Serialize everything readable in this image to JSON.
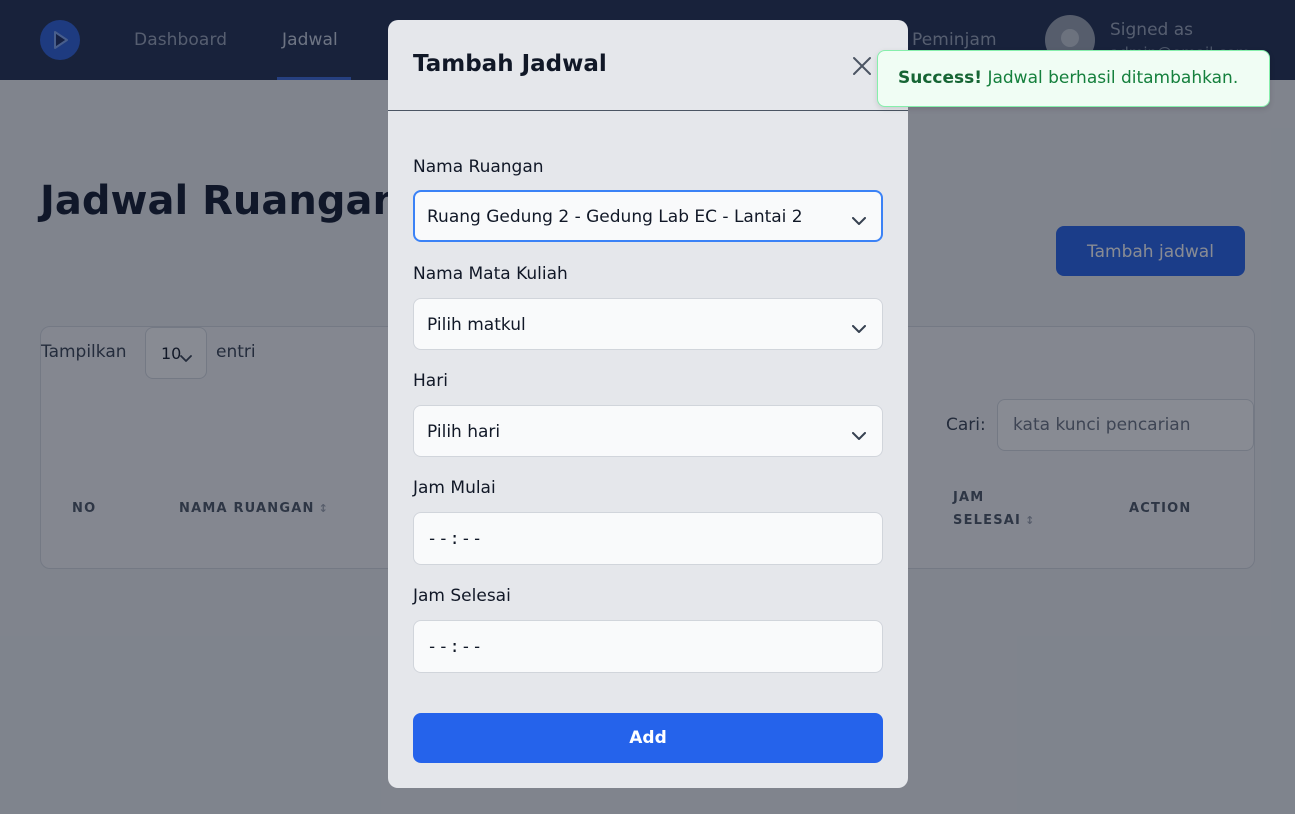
{
  "navbar": {
    "items": [
      {
        "label": "Dashboard"
      },
      {
        "label": "Jadwal"
      },
      {
        "label": "Peminjam"
      }
    ],
    "user": {
      "signed_label": "Signed as",
      "account": "admin@email.com"
    }
  },
  "page": {
    "title": "Jadwal Ruangan Kuliah",
    "add_button": "Tambah jadwal"
  },
  "table_controls": {
    "show_label": "Tampilkan",
    "entries_value": "10",
    "entries_label": "entri",
    "search_label": "Cari:",
    "search_placeholder": "kata kunci pencarian"
  },
  "table": {
    "headers": [
      "NO",
      "NAMA RUANGAN",
      "JAM SELESAI",
      "ACTION"
    ],
    "sort_icon": "↕"
  },
  "modal": {
    "title": "Tambah Jadwal",
    "fields": {
      "room": {
        "label": "Nama Ruangan",
        "value": "Ruang Gedung 2 - Gedung Lab EC - Lantai 2"
      },
      "course": {
        "label": "Nama Mata Kuliah",
        "value": "Pilih matkul"
      },
      "day": {
        "label": "Hari",
        "value": "Pilih hari"
      },
      "start": {
        "label": "Jam Mulai",
        "value": "--:--"
      },
      "end": {
        "label": "Jam Selesai",
        "value": "--:--"
      }
    },
    "submit_label": "Add"
  },
  "toast": {
    "strong": "Success!",
    "message": "Jadwal berhasil ditambahkan."
  },
  "icons": {
    "logo": "play-logo-icon",
    "close": "close-icon",
    "chevron": "chevron-down-icon",
    "sort": "sort-icon",
    "avatar": "avatar-icon"
  },
  "colors": {
    "navbar": "#1f2d4f",
    "primary": "#2563eb",
    "success_text": "#15803d",
    "success_bg": "#f0fdf4"
  }
}
